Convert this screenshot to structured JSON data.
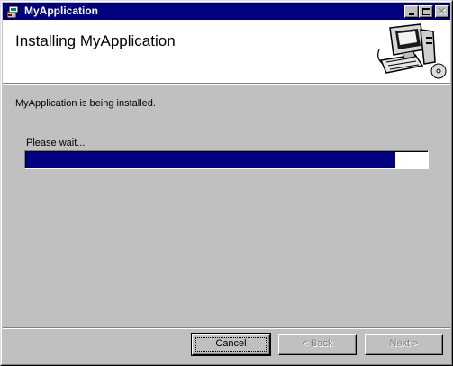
{
  "window": {
    "title": "MyApplication",
    "icon": "installer-app-icon"
  },
  "titlebar_buttons": {
    "minimize": "minimize-icon",
    "maximize": "maximize-icon",
    "close": "close-icon"
  },
  "header": {
    "title": "Installing MyApplication",
    "graphic": "computer-setup-icon"
  },
  "status": {
    "message": "MyApplication is being installed.",
    "wait_text": "Please wait..."
  },
  "progress": {
    "fraction": 0.92,
    "fill_color": "#000080"
  },
  "buttons": {
    "cancel": "Cancel",
    "back": "< Back",
    "next": "Next >"
  },
  "colors": {
    "titlebar": "#000080",
    "face": "#c0c0c0",
    "header_bg": "#ffffff"
  }
}
